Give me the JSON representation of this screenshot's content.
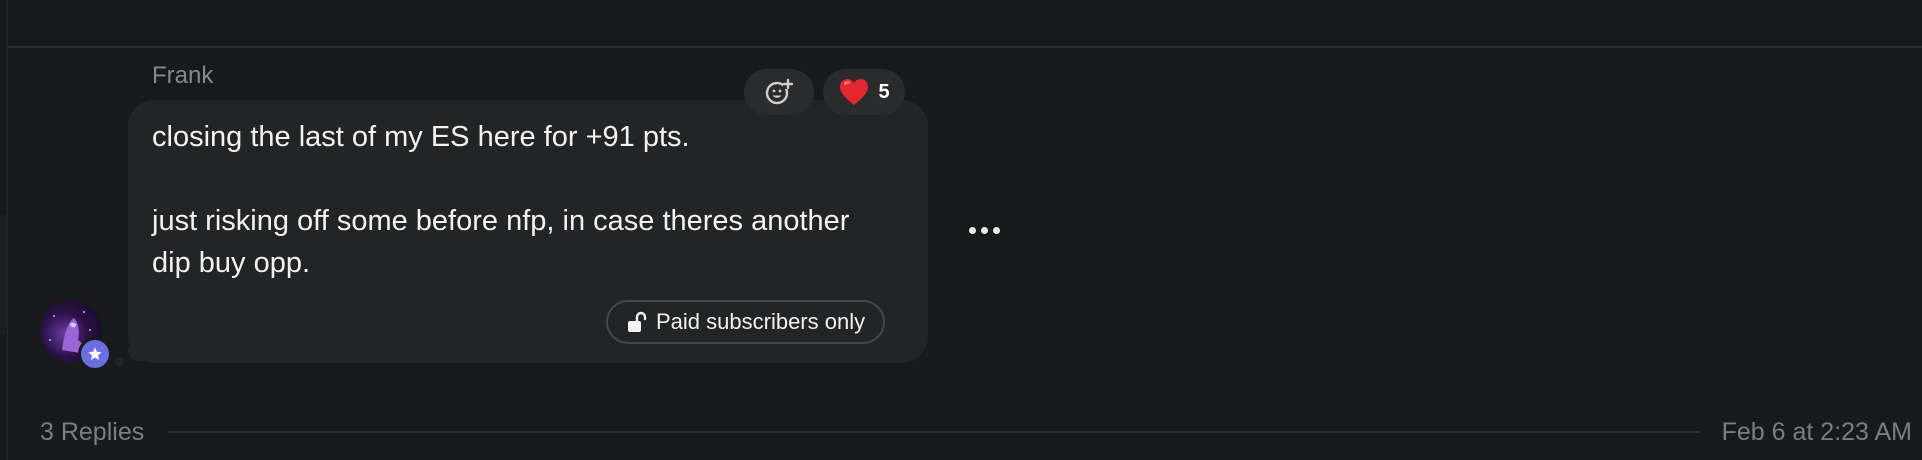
{
  "message": {
    "author": "Frank",
    "text_lines": [
      "closing the last of my ES here for +91 pts.",
      "",
      "just risking off some before nfp, in case theres another",
      "dip buy opp."
    ],
    "paid_badge_label": "Paid subscribers only",
    "reactions": {
      "add_reaction_icon": "add-emoji-icon",
      "heart_emoji": "❤️",
      "heart_count": "5"
    },
    "more_icon": "ellipsis-icon",
    "avatar_badge_icon": "star-icon"
  },
  "footer": {
    "replies_label": "3 Replies",
    "timestamp": "Feb 6 at 2:23 AM"
  },
  "colors": {
    "background": "#18191b",
    "bubble": "#222425",
    "badge_accent": "#6a6ee0",
    "heart": "#e0245e"
  }
}
